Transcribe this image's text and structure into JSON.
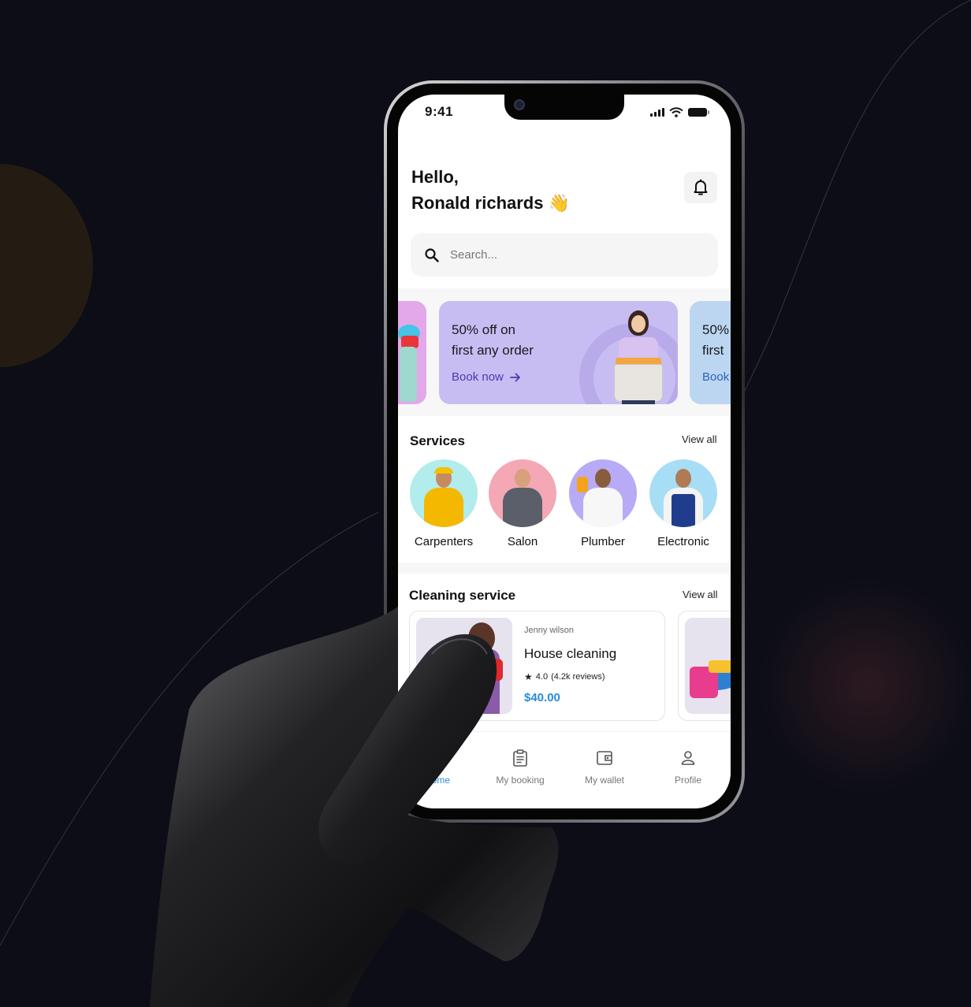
{
  "status_bar": {
    "time": "9:41"
  },
  "header": {
    "greeting": "Hello,",
    "user_name": "Ronald richards 👋",
    "notification_icon": "bell-icon"
  },
  "search": {
    "placeholder": "Search...",
    "value": "",
    "icon": "search-icon"
  },
  "promos": [
    {
      "title_line1": "",
      "title_line2": "",
      "link": "",
      "color": "#e2a8ea"
    },
    {
      "title_line1": "50% off on",
      "title_line2": "first any order",
      "link": "Book now",
      "link_icon": "arrow-right-icon",
      "color": "#c8bdf2"
    },
    {
      "title_line1": "50%",
      "title_line2": "first",
      "link": "Book",
      "color": "#bcd6f2"
    }
  ],
  "services": {
    "title": "Services",
    "view_all": "View all",
    "items": [
      {
        "label": "Carpenters",
        "color": "#b2ecec"
      },
      {
        "label": "Salon",
        "color": "#f4a7b4"
      },
      {
        "label": "Plumber",
        "color": "#b9aaf5"
      },
      {
        "label": "Electronic",
        "color": "#a8def5"
      }
    ]
  },
  "cleaning": {
    "title": "Cleaning service",
    "view_all": "View all",
    "cards": [
      {
        "provider": "Jenny wilson",
        "title": "House cleaning",
        "rating": "4.0",
        "reviews": "(4.2k reviews)",
        "price": "$40.00"
      }
    ]
  },
  "tabbar": {
    "items": [
      {
        "label": "Home",
        "icon": "home-icon",
        "active": true
      },
      {
        "label": "My booking",
        "icon": "clipboard-icon"
      },
      {
        "label": "My wallet",
        "icon": "wallet-icon"
      },
      {
        "label": "Profile",
        "icon": "user-icon"
      }
    ]
  },
  "colors": {
    "accent": "#2a8bd8",
    "promo_link": "#4b39b0",
    "background": "#0c0d17"
  }
}
